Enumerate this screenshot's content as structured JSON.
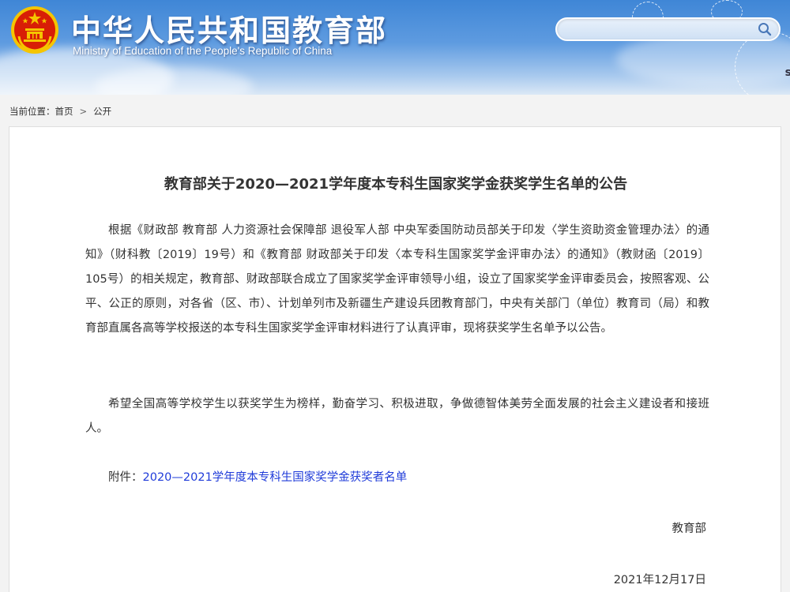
{
  "header": {
    "title": "中华人民共和国教育部",
    "subtitle": "Ministry of Education of the People's Republic of China",
    "search": {
      "value": "",
      "placeholder": ""
    },
    "edge_fragment": "s"
  },
  "breadcrumb": {
    "label": "当前位置：",
    "items": [
      "首页",
      "公开"
    ]
  },
  "article": {
    "title": "教育部关于2020—2021学年度本专科生国家奖学金获奖学生名单的公告",
    "paragraphs": [
      "根据《财政部 教育部 人力资源社会保障部 退役军人部 中央军委国防动员部关于印发〈学生资助资金管理办法〉的通知》（财科教〔2019〕19号）和《教育部 财政部关于印发〈本专科生国家奖学金评审办法〉的通知》（教财函〔2019〕105号）的相关规定，教育部、财政部联合成立了国家奖学金评审领导小组，设立了国家奖学金评审委员会，按照客观、公平、公正的原则，对各省（区、市）、计划单列市及新疆生产建设兵团教育部门，中央有关部门（单位）教育司（局）和教育部直属各高等学校报送的本专科生国家奖学金评审材料进行了认真评审，现将获奖学生名单予以公告。",
      "希望全国高等学校学生以获奖学生为榜样，勤奋学习、积极进取，争做德智体美劳全面发展的社会主义建设者和接班人。"
    ],
    "attachment_label": "附件：",
    "attachment_link": "2020—2021学年度本专科生国家奖学金获奖者名单",
    "signer": "教育部",
    "date": "2021年12月17日"
  },
  "colors": {
    "link": "#1f3bd9",
    "header_blue": "#3f86d6",
    "emblem_red": "#d81e06",
    "emblem_gold": "#f5c500"
  }
}
